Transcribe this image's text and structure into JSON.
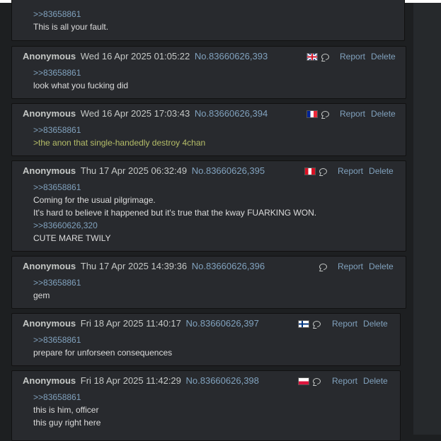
{
  "actions": {
    "report": "Report",
    "delete": "Delete"
  },
  "top_post": {
    "lines": [
      {
        "text": ">>83658861",
        "kind": "quote"
      },
      {
        "text": "This is all your fault.",
        "kind": "text"
      }
    ]
  },
  "posts": [
    {
      "name": "Anonymous",
      "date": "Wed 16 Apr 2025 01:05:22",
      "no": "No.83660626,393",
      "flag": "uk",
      "lines": [
        {
          "text": ">>83658861",
          "kind": "quote"
        },
        {
          "text": "look what you fucking did",
          "kind": "text"
        }
      ]
    },
    {
      "name": "Anonymous",
      "date": "Wed 16 Apr 2025 17:03:43",
      "no": "No.83660626,394",
      "flag": "fr",
      "lines": [
        {
          "text": ">>83658861",
          "kind": "quote"
        },
        {
          "text": ">the anon that single-handedly destroy 4chan",
          "kind": "greentext"
        }
      ]
    },
    {
      "name": "Anonymous",
      "date": "Thu 17 Apr 2025 06:32:49",
      "no": "No.83660626,395",
      "flag": "pe",
      "lines": [
        {
          "text": ">>83658861",
          "kind": "quote"
        },
        {
          "text": "Coming for the usual pilgrimage.",
          "kind": "text"
        },
        {
          "text": "It's hard to believe it happened but it's true that the kway FUARKING WON.",
          "kind": "text"
        },
        {
          "text": ">>83660626,320",
          "kind": "quote"
        },
        {
          "text": "CUTE MARE TWILY",
          "kind": "text"
        }
      ]
    },
    {
      "name": "Anonymous",
      "date": "Thu 17 Apr 2025 14:39:36",
      "no": "No.83660626,396",
      "flag": "",
      "lines": [
        {
          "text": ">>83658861",
          "kind": "quote"
        },
        {
          "text": "gem",
          "kind": "text"
        }
      ]
    },
    {
      "name": "Anonymous",
      "date": "Fri 18 Apr 2025 11:40:17",
      "no": "No.83660626,397",
      "flag": "fi",
      "lines": [
        {
          "text": ">>83658861",
          "kind": "quote"
        },
        {
          "text": "prepare for unforseen consequences",
          "kind": "text"
        }
      ]
    },
    {
      "name": "Anonymous",
      "date": "Fri 18 Apr 2025 11:42:29",
      "no": "No.83660626,398",
      "flag": "pl",
      "lines": [
        {
          "text": ">>83658861",
          "kind": "quote"
        },
        {
          "text": "this is him, officer",
          "kind": "text"
        },
        {
          "text": "this guy right here",
          "kind": "text"
        }
      ]
    }
  ]
}
